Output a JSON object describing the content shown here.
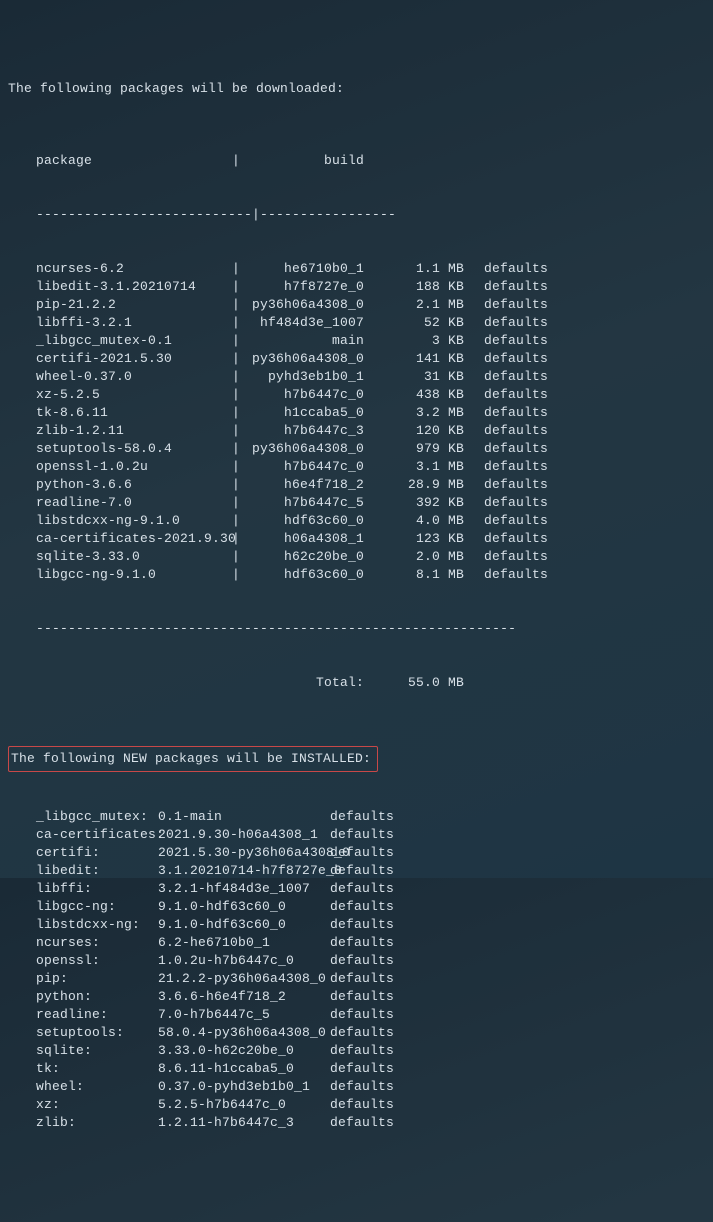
{
  "headers": {
    "download_title": "The following packages will be downloaded:",
    "package_col": "package",
    "build_col": "build",
    "separator": "|",
    "divider1": "---------------------------|-----------------",
    "divider2": "------------------------------------------------------------",
    "total_label": "Total:",
    "total_size": "55.0 MB",
    "install_title": "The following NEW packages will be INSTALLED:"
  },
  "downloads": [
    {
      "pkg": "ncurses-6.2",
      "build": "he6710b0_1",
      "size": "1.1 MB",
      "chan": "defaults"
    },
    {
      "pkg": "libedit-3.1.20210714",
      "build": "h7f8727e_0",
      "size": "188 KB",
      "chan": "defaults"
    },
    {
      "pkg": "pip-21.2.2",
      "build": "py36h06a4308_0",
      "size": "2.1 MB",
      "chan": "defaults"
    },
    {
      "pkg": "libffi-3.2.1",
      "build": "hf484d3e_1007",
      "size": "52 KB",
      "chan": "defaults"
    },
    {
      "pkg": "_libgcc_mutex-0.1",
      "build": "main",
      "size": "3 KB",
      "chan": "defaults"
    },
    {
      "pkg": "certifi-2021.5.30",
      "build": "py36h06a4308_0",
      "size": "141 KB",
      "chan": "defaults"
    },
    {
      "pkg": "wheel-0.37.0",
      "build": "pyhd3eb1b0_1",
      "size": "31 KB",
      "chan": "defaults"
    },
    {
      "pkg": "xz-5.2.5",
      "build": "h7b6447c_0",
      "size": "438 KB",
      "chan": "defaults"
    },
    {
      "pkg": "tk-8.6.11",
      "build": "h1ccaba5_0",
      "size": "3.2 MB",
      "chan": "defaults"
    },
    {
      "pkg": "zlib-1.2.11",
      "build": "h7b6447c_3",
      "size": "120 KB",
      "chan": "defaults"
    },
    {
      "pkg": "setuptools-58.0.4",
      "build": "py36h06a4308_0",
      "size": "979 KB",
      "chan": "defaults"
    },
    {
      "pkg": "openssl-1.0.2u",
      "build": "h7b6447c_0",
      "size": "3.1 MB",
      "chan": "defaults"
    },
    {
      "pkg": "python-3.6.6",
      "build": "h6e4f718_2",
      "size": "28.9 MB",
      "chan": "defaults"
    },
    {
      "pkg": "readline-7.0",
      "build": "h7b6447c_5",
      "size": "392 KB",
      "chan": "defaults"
    },
    {
      "pkg": "libstdcxx-ng-9.1.0",
      "build": "hdf63c60_0",
      "size": "4.0 MB",
      "chan": "defaults"
    },
    {
      "pkg": "ca-certificates-2021.9.30",
      "build": "h06a4308_1",
      "size": "123 KB",
      "chan": "defaults"
    },
    {
      "pkg": "sqlite-3.33.0",
      "build": "h62c20be_0",
      "size": "2.0 MB",
      "chan": "defaults"
    },
    {
      "pkg": "libgcc-ng-9.1.0",
      "build": "hdf63c60_0",
      "size": "8.1 MB",
      "chan": "defaults"
    }
  ],
  "installs": [
    {
      "pkg": "_libgcc_mutex:",
      "ver": "0.1-main",
      "chan": "defaults"
    },
    {
      "pkg": "ca-certificates:",
      "ver": "2021.9.30-h06a4308_1",
      "chan": "defaults"
    },
    {
      "pkg": "certifi:",
      "ver": "2021.5.30-py36h06a4308_0",
      "chan": "defaults"
    },
    {
      "pkg": "libedit:",
      "ver": "3.1.20210714-h7f8727e_0",
      "chan": "defaults"
    },
    {
      "pkg": "libffi:",
      "ver": "3.2.1-hf484d3e_1007",
      "chan": "defaults"
    },
    {
      "pkg": "libgcc-ng:",
      "ver": "9.1.0-hdf63c60_0",
      "chan": "defaults"
    },
    {
      "pkg": "libstdcxx-ng:",
      "ver": "9.1.0-hdf63c60_0",
      "chan": "defaults"
    },
    {
      "pkg": "ncurses:",
      "ver": "6.2-he6710b0_1",
      "chan": "defaults"
    },
    {
      "pkg": "openssl:",
      "ver": "1.0.2u-h7b6447c_0",
      "chan": "defaults"
    },
    {
      "pkg": "pip:",
      "ver": "21.2.2-py36h06a4308_0",
      "chan": "defaults"
    },
    {
      "pkg": "python:",
      "ver": "3.6.6-h6e4f718_2",
      "chan": "defaults"
    },
    {
      "pkg": "readline:",
      "ver": "7.0-h7b6447c_5",
      "chan": "defaults"
    },
    {
      "pkg": "setuptools:",
      "ver": "58.0.4-py36h06a4308_0",
      "chan": "defaults"
    },
    {
      "pkg": "sqlite:",
      "ver": "3.33.0-h62c20be_0",
      "chan": "defaults"
    },
    {
      "pkg": "tk:",
      "ver": "8.6.11-h1ccaba5_0",
      "chan": "defaults"
    },
    {
      "pkg": "wheel:",
      "ver": "0.37.0-pyhd3eb1b0_1",
      "chan": "defaults"
    },
    {
      "pkg": "xz:",
      "ver": "5.2.5-h7b6447c_0",
      "chan": "defaults"
    },
    {
      "pkg": "zlib:",
      "ver": "1.2.11-h7b6447c_3",
      "chan": "defaults"
    }
  ]
}
